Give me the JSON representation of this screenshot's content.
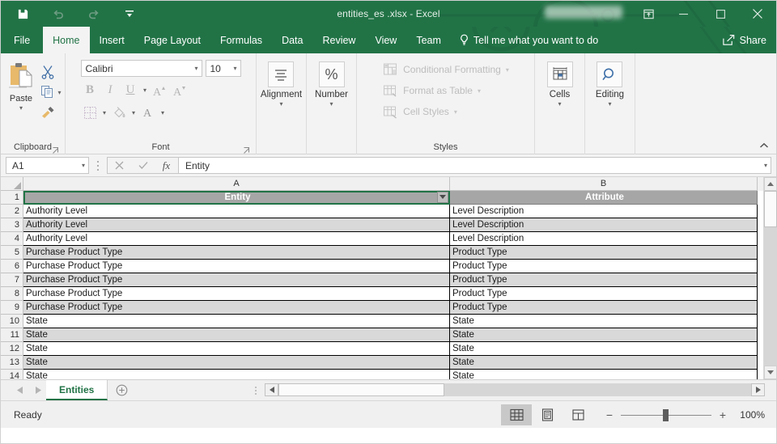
{
  "titlebar": {
    "quick_access": [
      {
        "name": "save",
        "icon": "save-icon",
        "enabled": true
      },
      {
        "name": "undo",
        "icon": "undo-icon",
        "enabled": false
      },
      {
        "name": "redo",
        "icon": "redo-icon",
        "enabled": false
      },
      {
        "name": "customize",
        "icon": "customize-quick-access-icon",
        "enabled": true
      }
    ],
    "document_title": "entities_es .xlsx  -  Excel",
    "ribbon_display_options": "ribbon-display-options-icon",
    "minimize": "minimize-icon",
    "maximize": "maximize-icon",
    "close": "close-icon"
  },
  "ribbon_tabs": {
    "items": [
      {
        "label": "File",
        "active": false
      },
      {
        "label": "Home",
        "active": true
      },
      {
        "label": "Insert",
        "active": false
      },
      {
        "label": "Page Layout",
        "active": false
      },
      {
        "label": "Formulas",
        "active": false
      },
      {
        "label": "Data",
        "active": false
      },
      {
        "label": "Review",
        "active": false
      },
      {
        "label": "View",
        "active": false
      },
      {
        "label": "Team",
        "active": false
      }
    ],
    "tell_me": "Tell me what you want to do",
    "share": "Share"
  },
  "ribbon": {
    "clipboard": {
      "label": "Clipboard",
      "paste": "Paste",
      "cut": "cut-icon",
      "copy": "copy-icon",
      "format_painter": "format-painter-icon"
    },
    "font": {
      "label": "Font",
      "font_name": "Calibri",
      "font_size": "10",
      "bold": "B",
      "italic": "I",
      "underline": "U",
      "increase_font_size": "A",
      "decrease_font_size": "A",
      "borders": "borders-icon",
      "fill_color": "fill-color-icon",
      "font_color": "A"
    },
    "alignment": {
      "label": "Alignment"
    },
    "number": {
      "label": "Number",
      "icon": "%"
    },
    "styles": {
      "label": "Styles",
      "items": [
        {
          "label": "Conditional Formatting",
          "icon": "conditional-formatting-icon"
        },
        {
          "label": "Format as Table",
          "icon": "format-as-table-icon"
        },
        {
          "label": "Cell Styles",
          "icon": "cell-styles-icon"
        }
      ]
    },
    "cells": {
      "label": "Cells"
    },
    "editing": {
      "label": "Editing"
    }
  },
  "formula_bar": {
    "name_box": "A1",
    "cancel": "cancel-icon",
    "enter": "enter-icon",
    "insert_function": "fx",
    "formula_value": "Entity"
  },
  "grid": {
    "columns": [
      {
        "id": "A",
        "label": "A"
      },
      {
        "id": "B",
        "label": "B"
      }
    ],
    "header_row": {
      "number": "1",
      "cells": [
        "Entity",
        "Attribute"
      ],
      "selected_cell": "A1",
      "filter_dropdown": true
    },
    "rows": [
      {
        "number": "2",
        "cells": [
          "Authority Level",
          "Level Description"
        ],
        "banded": false
      },
      {
        "number": "3",
        "cells": [
          "Authority Level",
          "Level Description"
        ],
        "banded": true
      },
      {
        "number": "4",
        "cells": [
          "Authority Level",
          "Level Description"
        ],
        "banded": false
      },
      {
        "number": "5",
        "cells": [
          "Purchase Product Type",
          "Product Type"
        ],
        "banded": true
      },
      {
        "number": "6",
        "cells": [
          "Purchase Product Type",
          "Product Type"
        ],
        "banded": false
      },
      {
        "number": "7",
        "cells": [
          "Purchase Product Type",
          "Product Type"
        ],
        "banded": true
      },
      {
        "number": "8",
        "cells": [
          "Purchase Product Type",
          "Product Type"
        ],
        "banded": false
      },
      {
        "number": "9",
        "cells": [
          "Purchase Product Type",
          "Product Type"
        ],
        "banded": true
      },
      {
        "number": "10",
        "cells": [
          "State",
          "State"
        ],
        "banded": false
      },
      {
        "number": "11",
        "cells": [
          "State",
          "State"
        ],
        "banded": true
      },
      {
        "number": "12",
        "cells": [
          "State",
          "State"
        ],
        "banded": false
      },
      {
        "number": "13",
        "cells": [
          "State",
          "State"
        ],
        "banded": true
      },
      {
        "number": "14",
        "cells": [
          "State",
          "State"
        ],
        "banded": false
      }
    ]
  },
  "sheet_tabs": {
    "prev": "previous-sheet-icon",
    "next": "next-sheet-icon",
    "sheets": [
      {
        "name": "Entities",
        "active": true
      }
    ],
    "add_sheet": "+"
  },
  "status_bar": {
    "status": "Ready",
    "views": [
      {
        "name": "normal",
        "icon": "normal-view-icon",
        "active": true
      },
      {
        "name": "page-layout",
        "icon": "page-layout-view-icon",
        "active": false
      },
      {
        "name": "page-break-preview",
        "icon": "page-break-preview-icon",
        "active": false
      }
    ],
    "zoom_out": "−",
    "zoom_in": "+",
    "zoom_level": "100%"
  },
  "colors": {
    "excel_green": "#217346",
    "ribbon_bg": "#f3f3f3",
    "table_header": "#A6A6A6",
    "table_band": "#D9D9D9"
  }
}
